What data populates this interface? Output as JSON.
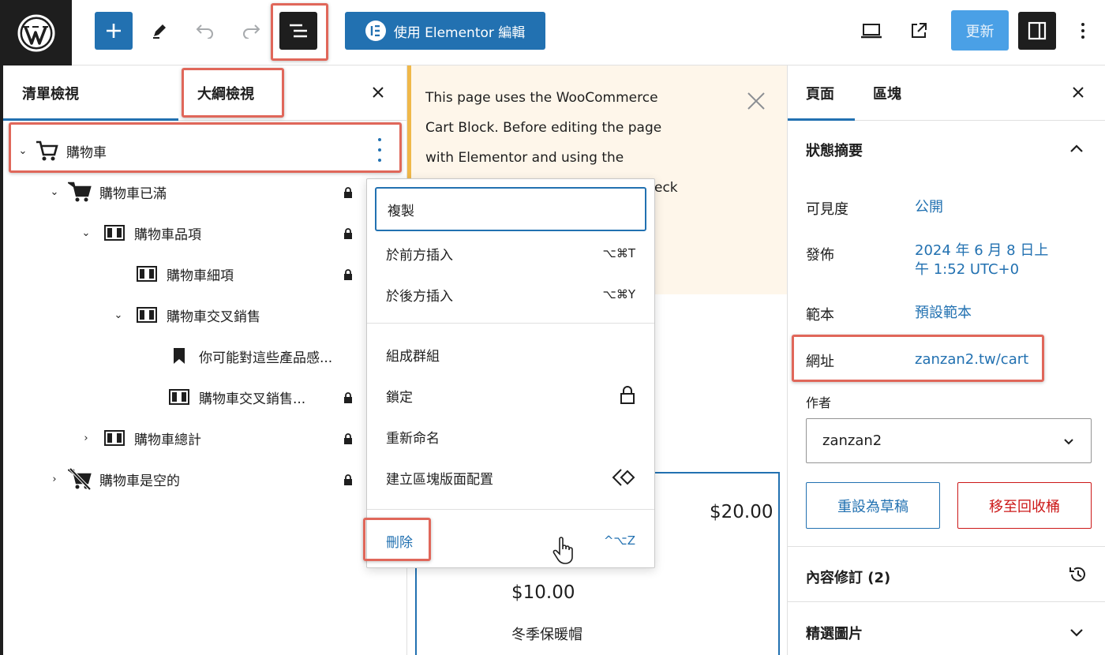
{
  "toolbar": {
    "elementor_label": "使用 Elementor 編輯",
    "update_label": "更新"
  },
  "left_panel": {
    "tabs": [
      "清單檢視",
      "大綱檢視"
    ],
    "tree": [
      {
        "label": "購物車"
      },
      {
        "label": "購物車已滿"
      },
      {
        "label": "購物車品項"
      },
      {
        "label": "購物車細項"
      },
      {
        "label": "購物車交叉銷售"
      },
      {
        "label": "你可能對這些產品感..."
      },
      {
        "label": "購物車交叉銷售..."
      },
      {
        "label": "購物車總計"
      },
      {
        "label": "購物車是空的"
      }
    ]
  },
  "canvas": {
    "notice_lines": [
      "This page uses the WooCommerce",
      "Cart Block. Before editing the page",
      "with Elementor and using the",
      "eck"
    ],
    "price_1": "$20.00",
    "price_2": "$10.00",
    "product_name": "冬季保暖帽"
  },
  "context_menu": {
    "items": [
      {
        "label": "複製",
        "shortcut": ""
      },
      {
        "label": "於前方插入",
        "shortcut": "⌥⌘T"
      },
      {
        "label": "於後方插入",
        "shortcut": "⌥⌘Y"
      },
      {
        "label": "組成群組",
        "shortcut": ""
      },
      {
        "label": "鎖定",
        "shortcut": ""
      },
      {
        "label": "重新命名",
        "shortcut": ""
      },
      {
        "label": "建立區塊版面配置",
        "shortcut": ""
      },
      {
        "label": "刪除",
        "shortcut": "^⌥Z"
      }
    ]
  },
  "right_panel": {
    "tabs": [
      "頁面",
      "區塊"
    ],
    "summary_title": "狀態摘要",
    "visibility_label": "可見度",
    "visibility_value": "公開",
    "publish_label": "發佈",
    "publish_value_1": "2024 年 6 月 8 日上",
    "publish_value_2": "午 1:52 UTC+0",
    "template_label": "範本",
    "template_value": "預設範本",
    "url_label": "網址",
    "url_value": "zanzan2.tw/cart",
    "author_label": "作者",
    "author_value": "zanzan2",
    "draft_label": "重設為草稿",
    "trash_label": "移至回收桶",
    "revisions_label": "內容修訂 (2)",
    "featured_label": "精選圖片"
  }
}
